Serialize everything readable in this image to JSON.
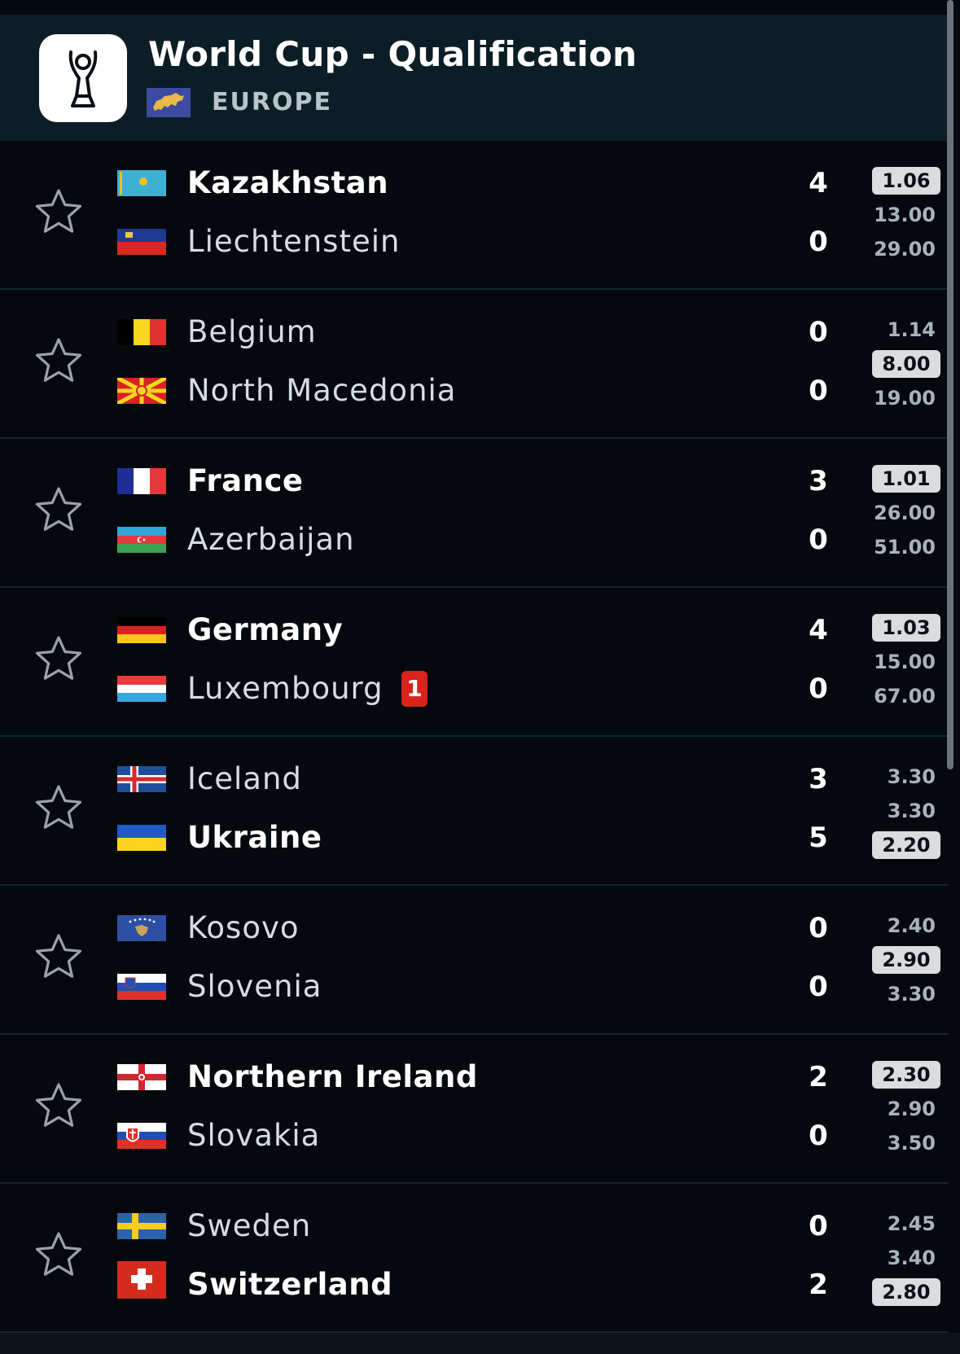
{
  "header": {
    "title": "World Cup - Qualification",
    "region": "EUROPE",
    "logo_icon": "trophy-icon",
    "region_flag_icon": "europe-flag-icon"
  },
  "colors": {
    "background": "#05090d",
    "header_bg": "#0c1e25",
    "selected_odd_bg": "#d9dde0",
    "red_card": "#d9231b"
  },
  "matches": [
    {
      "home": {
        "name": "Kazakhstan",
        "score": "4",
        "winner": true,
        "flag": "kazakhstan"
      },
      "away": {
        "name": "Liechtenstein",
        "score": "0",
        "winner": false,
        "flag": "liechtenstein"
      },
      "odds": [
        "1.06",
        "13.00",
        "29.00"
      ],
      "selected": 0
    },
    {
      "home": {
        "name": "Belgium",
        "score": "0",
        "winner": false,
        "flag": "belgium"
      },
      "away": {
        "name": "North Macedonia",
        "score": "0",
        "winner": false,
        "flag": "north-macedonia"
      },
      "odds": [
        "1.14",
        "8.00",
        "19.00"
      ],
      "selected": 1
    },
    {
      "home": {
        "name": "France",
        "score": "3",
        "winner": true,
        "flag": "france"
      },
      "away": {
        "name": "Azerbaijan",
        "score": "0",
        "winner": false,
        "flag": "azerbaijan"
      },
      "odds": [
        "1.01",
        "26.00",
        "51.00"
      ],
      "selected": 0
    },
    {
      "home": {
        "name": "Germany",
        "score": "4",
        "winner": true,
        "flag": "germany"
      },
      "away": {
        "name": "Luxembourg",
        "score": "0",
        "winner": false,
        "flag": "luxembourg",
        "red_cards": "1"
      },
      "odds": [
        "1.03",
        "15.00",
        "67.00"
      ],
      "selected": 0
    },
    {
      "home": {
        "name": "Iceland",
        "score": "3",
        "winner": false,
        "flag": "iceland"
      },
      "away": {
        "name": "Ukraine",
        "score": "5",
        "winner": true,
        "flag": "ukraine"
      },
      "odds": [
        "3.30",
        "3.30",
        "2.20"
      ],
      "selected": 2
    },
    {
      "home": {
        "name": "Kosovo",
        "score": "0",
        "winner": false,
        "flag": "kosovo"
      },
      "away": {
        "name": "Slovenia",
        "score": "0",
        "winner": false,
        "flag": "slovenia"
      },
      "odds": [
        "2.40",
        "2.90",
        "3.30"
      ],
      "selected": 1
    },
    {
      "home": {
        "name": "Northern Ireland",
        "score": "2",
        "winner": true,
        "flag": "northern-ireland"
      },
      "away": {
        "name": "Slovakia",
        "score": "0",
        "winner": false,
        "flag": "slovakia"
      },
      "odds": [
        "2.30",
        "2.90",
        "3.50"
      ],
      "selected": 0
    },
    {
      "home": {
        "name": "Sweden",
        "score": "0",
        "winner": false,
        "flag": "sweden"
      },
      "away": {
        "name": "Switzerland",
        "score": "2",
        "winner": true,
        "flag": "switzerland"
      },
      "odds": [
        "2.45",
        "3.40",
        "2.80"
      ],
      "selected": 2
    }
  ]
}
